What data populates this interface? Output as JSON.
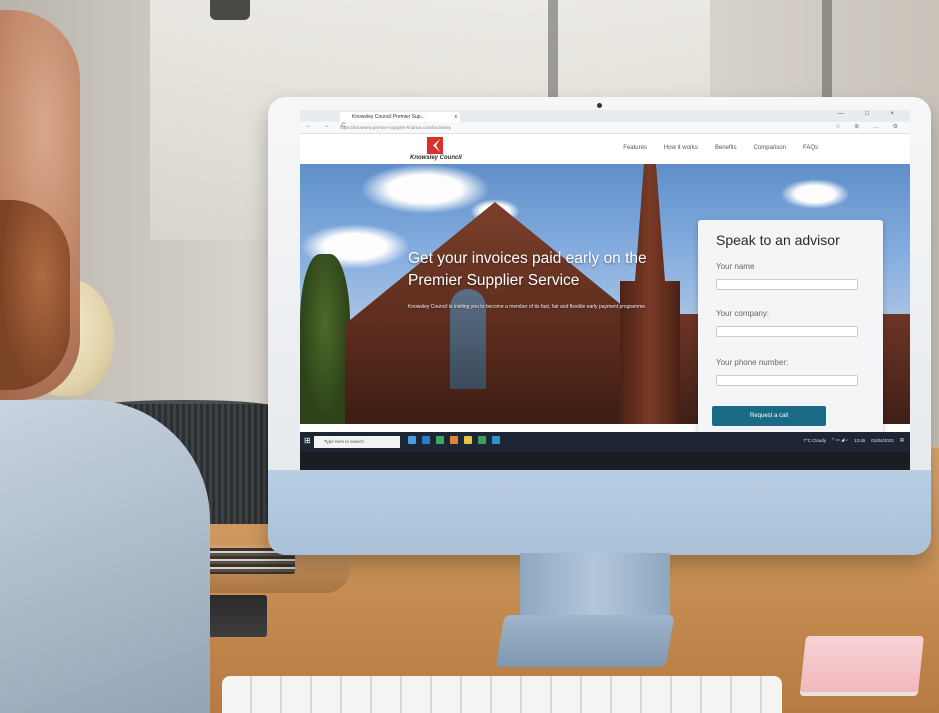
{
  "browser": {
    "tab_title": "Knowsley Council Premier Sup...",
    "tab_close": "x",
    "window_controls": "— □ ×",
    "nav_buttons": "← →  C",
    "url": "https://knowsley.premier-supplier-finance.com/knowsley",
    "address_icons": "☆ ⊕ … ⚙"
  },
  "site": {
    "logo_text": "Knowsley Council",
    "nav": [
      "Features",
      "How it works",
      "Benefits",
      "Comparison",
      "FAQs"
    ],
    "hero": {
      "title_line1": "Get your invoices paid early on the",
      "title_line2": "Premier Supplier Service",
      "subtitle": "Knowsley Council is inviting you to become a member of its fast, fair and flexible early payment programme."
    },
    "advisor_form": {
      "title": "Speak to an advisor",
      "name_label": "Your name",
      "company_label": "Your company:",
      "phone_label": "Your phone number:",
      "button_label": "Request a call"
    }
  },
  "taskbar": {
    "search_placeholder": "Type here to search",
    "weather": "7°C Cloudy",
    "time": "13:45",
    "date": "01/04/2022"
  },
  "colors": {
    "accent": "#1b6a85",
    "logo_red": "#d9302b",
    "taskbar": "#1f2633"
  }
}
